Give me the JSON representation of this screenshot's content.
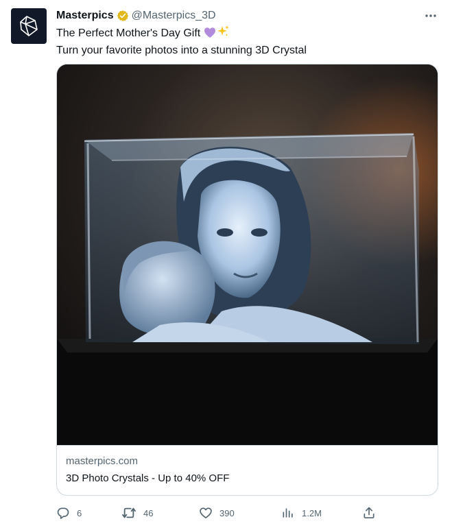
{
  "tweet": {
    "author_name": "Masterpics",
    "author_handle": "@Masterpics_3D",
    "line1": "The Perfect Mother's Day Gift",
    "line1_emojis": [
      "purple-heart",
      "sparkles"
    ],
    "line2": "Turn your favorite photos into a stunning 3D Crystal"
  },
  "card": {
    "domain": "masterpics.com",
    "title": "3D Photo Crystals - Up to 40% OFF"
  },
  "actions": {
    "replies": "6",
    "retweets": "46",
    "likes": "390",
    "views": "1.2M"
  },
  "icons": {
    "avatar": "crystal-logo-icon",
    "verified": "verified-badge-icon",
    "more": "more-icon",
    "reply": "reply-icon",
    "retweet": "retweet-icon",
    "like": "heart-icon",
    "views": "views-icon",
    "share": "share-icon"
  },
  "colors": {
    "text": "#0f1419",
    "muted": "#536471",
    "verified_gold": "#e2b719",
    "border": "#cfd9de"
  }
}
